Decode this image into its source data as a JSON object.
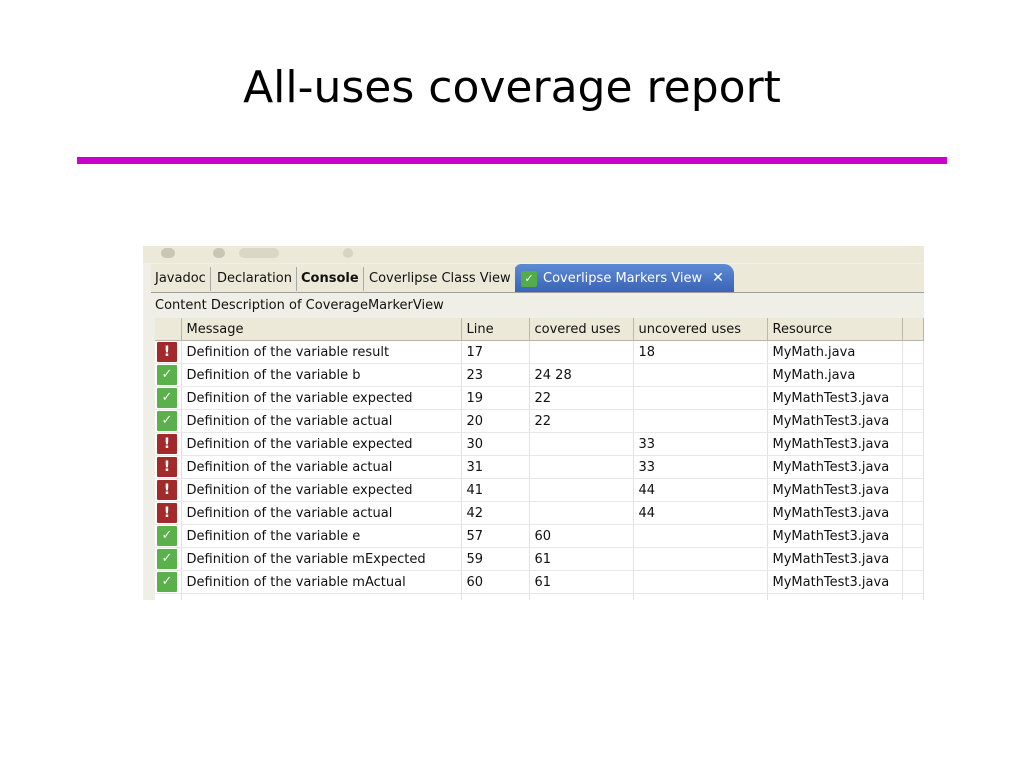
{
  "slide": {
    "title": "All-uses coverage report"
  },
  "tabs": [
    {
      "label": "Javadoc",
      "active": false,
      "bold": false
    },
    {
      "label": "Declaration",
      "active": false,
      "bold": false
    },
    {
      "label": "Console",
      "active": false,
      "bold": true
    },
    {
      "label": "Coverlipse Class View",
      "active": false,
      "bold": false
    },
    {
      "label": "Coverlipse Markers View",
      "active": true,
      "bold": false,
      "icon": "check-icon",
      "close_icon": "close-icon"
    }
  ],
  "view": {
    "content_description": "Content Description of CoverageMarkerView"
  },
  "table": {
    "columns": [
      "",
      "Message",
      "Line",
      "covered uses",
      "uncovered uses",
      "Resource"
    ],
    "rows": [
      {
        "status": "fail",
        "message": "Definition of the variable result",
        "line": "17",
        "covered": "",
        "uncovered": "18",
        "resource": "MyMath.java"
      },
      {
        "status": "pass",
        "message": "Definition of the variable b",
        "line": "23",
        "covered": "24 28",
        "uncovered": "",
        "resource": "MyMath.java"
      },
      {
        "status": "pass",
        "message": "Definition of the variable expected",
        "line": "19",
        "covered": "22",
        "uncovered": "",
        "resource": "MyMathTest3.java"
      },
      {
        "status": "pass",
        "message": "Definition of the variable actual",
        "line": "20",
        "covered": "22",
        "uncovered": "",
        "resource": "MyMathTest3.java"
      },
      {
        "status": "fail",
        "message": "Definition of the variable expected",
        "line": "30",
        "covered": "",
        "uncovered": "33",
        "resource": "MyMathTest3.java"
      },
      {
        "status": "fail",
        "message": "Definition of the variable actual",
        "line": "31",
        "covered": "",
        "uncovered": "33",
        "resource": "MyMathTest3.java"
      },
      {
        "status": "fail",
        "message": "Definition of the variable expected",
        "line": "41",
        "covered": "",
        "uncovered": "44",
        "resource": "MyMathTest3.java"
      },
      {
        "status": "fail",
        "message": "Definition of the variable actual",
        "line": "42",
        "covered": "",
        "uncovered": "44",
        "resource": "MyMathTest3.java"
      },
      {
        "status": "pass",
        "message": "Definition of the variable e",
        "line": "57",
        "covered": "60",
        "uncovered": "",
        "resource": "MyMathTest3.java"
      },
      {
        "status": "pass",
        "message": "Definition of the variable mExpected",
        "line": "59",
        "covered": "61",
        "uncovered": "",
        "resource": "MyMathTest3.java"
      },
      {
        "status": "pass",
        "message": "Definition of the variable mActual",
        "line": "60",
        "covered": "61",
        "uncovered": "",
        "resource": "MyMathTest3.java"
      }
    ]
  },
  "icons": {
    "fail": {
      "name": "error-icon",
      "glyph": "!"
    },
    "pass": {
      "name": "check-icon",
      "glyph": "✓"
    }
  },
  "colors": {
    "title_rule": "#cc00cc",
    "fail_icon": "#a32a2a",
    "pass_icon": "#5ab04a",
    "active_tab": "#3a64b8"
  }
}
